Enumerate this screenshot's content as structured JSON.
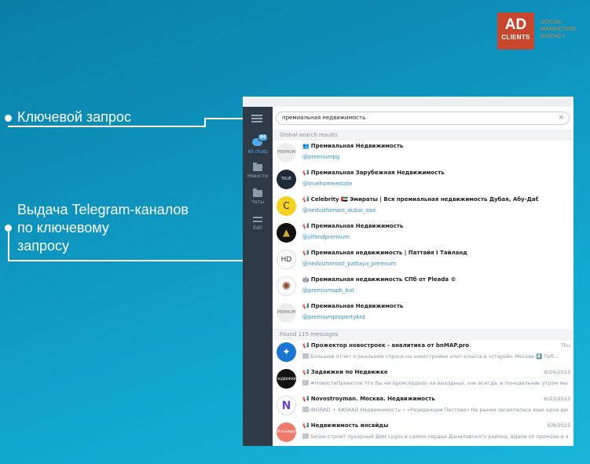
{
  "logo": {
    "big": "AD",
    "small": "CLIENTS",
    "tagline": [
      "SOCIAL",
      "MARKETING",
      "AGENCY"
    ]
  },
  "annotations": {
    "keyword": "Ключевой запрос",
    "results": [
      "Выдача Telegram-каналов",
      "по ключевому",
      "запросу"
    ]
  },
  "sidebar": {
    "items": [
      {
        "label": "All chats",
        "badge": "84"
      },
      {
        "label": "Новости"
      },
      {
        "label": "Чаты"
      },
      {
        "label": "Edit"
      }
    ]
  },
  "search": {
    "value": "премиальная недвижимость",
    "clear": "×"
  },
  "sections": {
    "global": "Global search results",
    "messages": "Found 115 messages"
  },
  "colors": {
    "accent": "#4fa8e8",
    "sidebar": "#2f3a47",
    "link": "#3a8fd1",
    "logo": "#c8462c"
  },
  "channels": [
    {
      "prefix": "👥",
      "title": "Премиальная Недвижимость",
      "handle": "@premiumpg",
      "avatar_text": "PREMIUM"
    },
    {
      "prefix": "📢",
      "title": "Премиальная Зарубежная Недвижимость",
      "handle": "@truehomeestate",
      "avatar_text": "TRUE HOME"
    },
    {
      "prefix": "📢",
      "title": "Celebrity 🇦🇪 Эмираты | Вся премиальная недвижимость Дубая, Абу-Даби и пр.",
      "handle": "@nedvizhimost_dubai_oae",
      "avatar_text": "C"
    },
    {
      "prefix": "📢",
      "title": "Премиальная Недвижимость",
      "handle": "@jilfondpremium",
      "avatar_text": "▲"
    },
    {
      "prefix": "📢",
      "title": "Премиальная недвижимость | Паттайя I Тайланд",
      "handle": "@nedvizhimost_pattaya_premium",
      "avatar_text": "HD"
    },
    {
      "prefix": "🤖",
      "title": "Премиальная недвижимость СПб от Pleada ©",
      "handle": "@premiumspb_bot",
      "avatar_text": "✺"
    },
    {
      "prefix": "📢",
      "title": "Премиальная Недвижимость",
      "handle": "@premiumpropertykrd",
      "avatar_text": "PREMIUM"
    }
  ],
  "messages": [
    {
      "prefix": "📢",
      "title": "Прожектор новостроек - аналитика от bnMAP.pro",
      "date": "Thu",
      "text": "Большой отчет о реальном спросе на новостройки элит-класса в «старой» Москве 4️⃣ Пуб...",
      "avatar_text": "✦"
    },
    {
      "prefix": "📢",
      "title": "Задвижки по Недвижке",
      "date": "6/26/2023",
      "text": "#НовостиПроектов Что бы ни происходило на выходных, как всегда, в понедельник утром мы от...",
      "avatar_text": "ЗАДВИЖКИ"
    },
    {
      "prefix": "📢",
      "title": "Novostroyman. Москва. Недвижимость",
      "date": "6/23/2023",
      "text": "INGRAD + KASKAD Недвижимость » «Резиденции Пестово» На рынке засветилась еще одна дев...",
      "avatar_text": "N"
    },
    {
      "prefix": "📢",
      "title": "Недвижимость инсайды",
      "date": "6/8/2023",
      "text": "Sense строит лухарный Дом Logos в самом сердце Даниловского района, вдали от промзон и ж...",
      "avatar_text": "Инсайды"
    }
  ]
}
